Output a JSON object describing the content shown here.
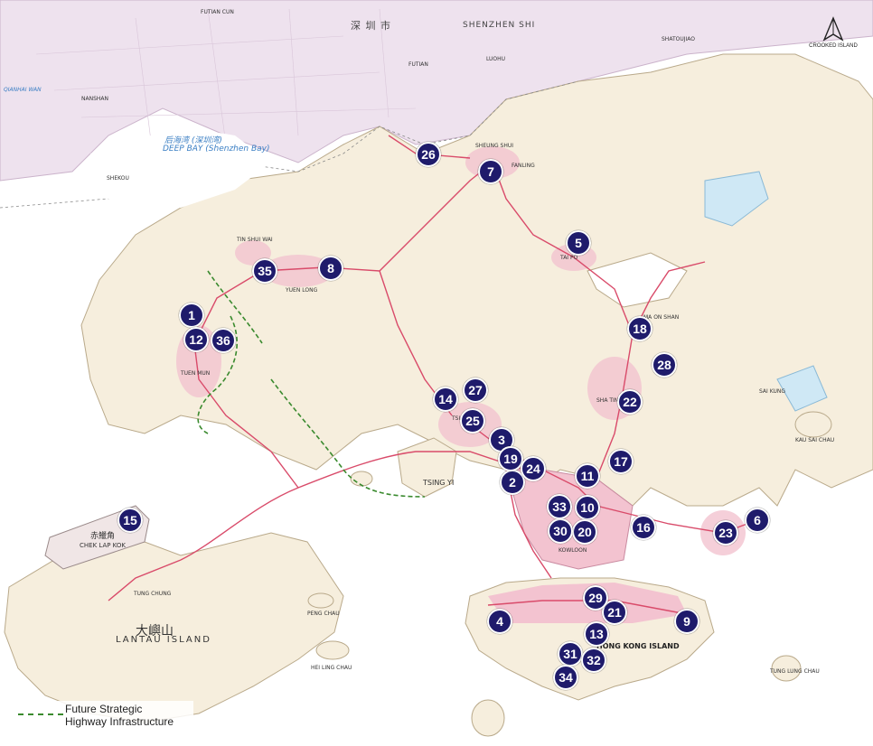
{
  "map": {
    "top_labels": {
      "shenzhen_cn": "深 圳 市",
      "shenzhen_en": "SHENZHEN SHI",
      "fuyong": "FUTIAN",
      "luohu": "LUOHU",
      "nanshan": "NANSHAN",
      "shekou": "SHEKOU",
      "qianhai": "QIANHAI WAN",
      "deep_bay_cn": "后海湾 (深圳湾)",
      "deep_bay_en": "DEEP BAY (Shenzhen Bay)",
      "futian_top": "FUTIAN CUN",
      "shatoujiao": "SHATOUJIAO",
      "crooked_island": "CROOKED ISLAND"
    },
    "place_labels": {
      "yuen_long": "YUEN LONG",
      "tin_shui_wai": "TIN SHUI WAI",
      "tuen_mun": "TUEN MUN",
      "sheung_shui": "SHEUNG SHUI",
      "fanling": "FANLING",
      "tai_po": "TAI PO",
      "ma_on_shan": "MA ON SHAN",
      "sha_tin": "SHA TIN",
      "tsuen_wan": "TSUEN WAN",
      "tsing_yi": "TSING YI",
      "sai_kung": "SAI KUNG",
      "kowloon": "KOWLOON",
      "hk_island": "HONG KONG ISLAND",
      "lantau_cn": "大嶼山",
      "lantau_en": "LANTAU ISLAND",
      "chek_lap_kok_cn": "赤鱲角",
      "chek_lap_kok_en": "CHEK LAP KOK",
      "tung_chung": "TUNG CHUNG",
      "peng_chau": "PENG CHAU",
      "hei_ling_chau": "HEI LING CHAU",
      "kau_sai_chau": "KAU SAI CHAU",
      "tung_lung_chau": "TUNG LUNG CHAU"
    },
    "markers": [
      "1",
      "2",
      "3",
      "4",
      "5",
      "6",
      "7",
      "8",
      "9",
      "10",
      "11",
      "12",
      "13",
      "14",
      "15",
      "16",
      "17",
      "18",
      "19",
      "20",
      "21",
      "22",
      "23",
      "24",
      "25",
      "26",
      "27",
      "28",
      "29",
      "30",
      "31",
      "32",
      "33",
      "34",
      "35",
      "36"
    ],
    "legend": {
      "line1": "Future Strategic",
      "line2": "Highway Infrastructure"
    },
    "colors": {
      "marker": "#1f1b6b",
      "sea": "#ffffff",
      "land": "#f5ecd9",
      "urban": "#f2b9c9",
      "road": "#d94b6a",
      "future_highway": "#3a8a2e",
      "water_body": "#cfe8f5",
      "shenzhen_urban": "#eadcea"
    }
  }
}
